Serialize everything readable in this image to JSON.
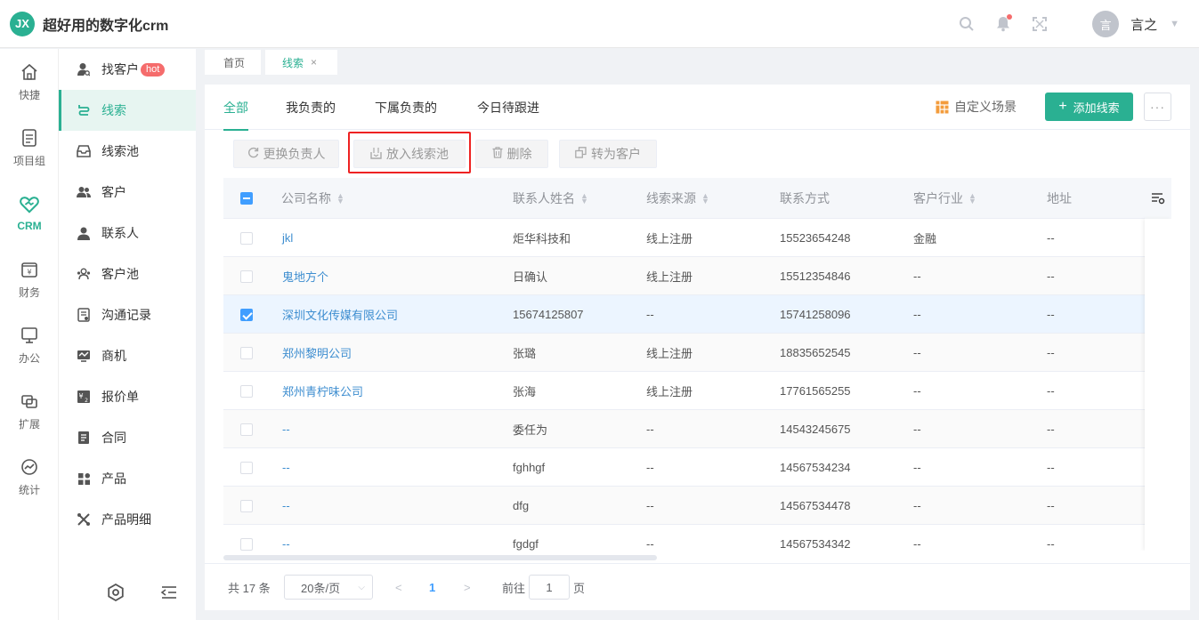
{
  "app": {
    "logo_text": "JX",
    "title": "超好用的数字化crm"
  },
  "header": {
    "user_avatar_text": "言",
    "user_name": "言之"
  },
  "rail": [
    {
      "label": "快捷",
      "icon": "home-icon"
    },
    {
      "label": "项目组",
      "icon": "document-icon"
    },
    {
      "label": "CRM",
      "icon": "heart-handshake-icon",
      "active": true
    },
    {
      "label": "财务",
      "icon": "yuan-icon"
    },
    {
      "label": "办公",
      "icon": "monitor-icon"
    },
    {
      "label": "扩展",
      "icon": "extend-icon"
    },
    {
      "label": "统计",
      "icon": "chart-circle-icon"
    }
  ],
  "submenu": {
    "items": [
      {
        "label": "找客户",
        "badge": "hot"
      },
      {
        "label": "线索",
        "active": true
      },
      {
        "label": "线索池"
      },
      {
        "label": "客户"
      },
      {
        "label": "联系人"
      },
      {
        "label": "客户池"
      },
      {
        "label": "沟通记录"
      },
      {
        "label": "商机"
      },
      {
        "label": "报价单"
      },
      {
        "label": "合同"
      },
      {
        "label": "产品"
      },
      {
        "label": "产品明细"
      }
    ]
  },
  "page_tabs": {
    "home": "首页",
    "current": "线索",
    "close": "×"
  },
  "scene_tabs": [
    "全部",
    "我负责的",
    "下属负责的",
    "今日待跟进"
  ],
  "toolbar": {
    "custom_scene": "自定义场景",
    "add_button": "添加线索",
    "more": "···"
  },
  "actions": [
    "更换负责人",
    "放入线索池",
    "删除",
    "转为客户"
  ],
  "table": {
    "columns": [
      "公司名称",
      "联系人姓名",
      "线索来源",
      "联系方式",
      "客户行业",
      "地址"
    ],
    "rows": [
      [
        "jkl",
        "炬华科技和",
        "线上注册",
        "15523654248",
        "金融",
        "--"
      ],
      [
        "鬼地方个",
        "日确认",
        "线上注册",
        "15512354846",
        "--",
        "--"
      ],
      [
        "深圳文化传媒有限公司",
        "15674125807",
        "--",
        "15741258096",
        "--",
        "--"
      ],
      [
        "郑州黎明公司",
        "张璐",
        "线上注册",
        "18835652545",
        "--",
        "--"
      ],
      [
        "郑州青柠味公司",
        "张海",
        "线上注册",
        "17761565255",
        "--",
        "--"
      ],
      [
        "--",
        "委任为",
        "--",
        "14543245675",
        "--",
        "--"
      ],
      [
        "--",
        "fghhgf",
        "--",
        "14567534234",
        "--",
        "--"
      ],
      [
        "--",
        "dfg",
        "--",
        "14567534478",
        "--",
        "--"
      ],
      [
        "--",
        "fgdgf",
        "--",
        "14567534342",
        "--",
        "--"
      ]
    ]
  },
  "pagination": {
    "total": "共 17 条",
    "page_size": "20条/页",
    "current_page": "1",
    "goto_label": "前往",
    "goto_value": "1",
    "page_suffix": "页"
  },
  "colors": {
    "accent": "#2ab092",
    "link": "#3e8ed0",
    "highlight": "#e22222"
  }
}
